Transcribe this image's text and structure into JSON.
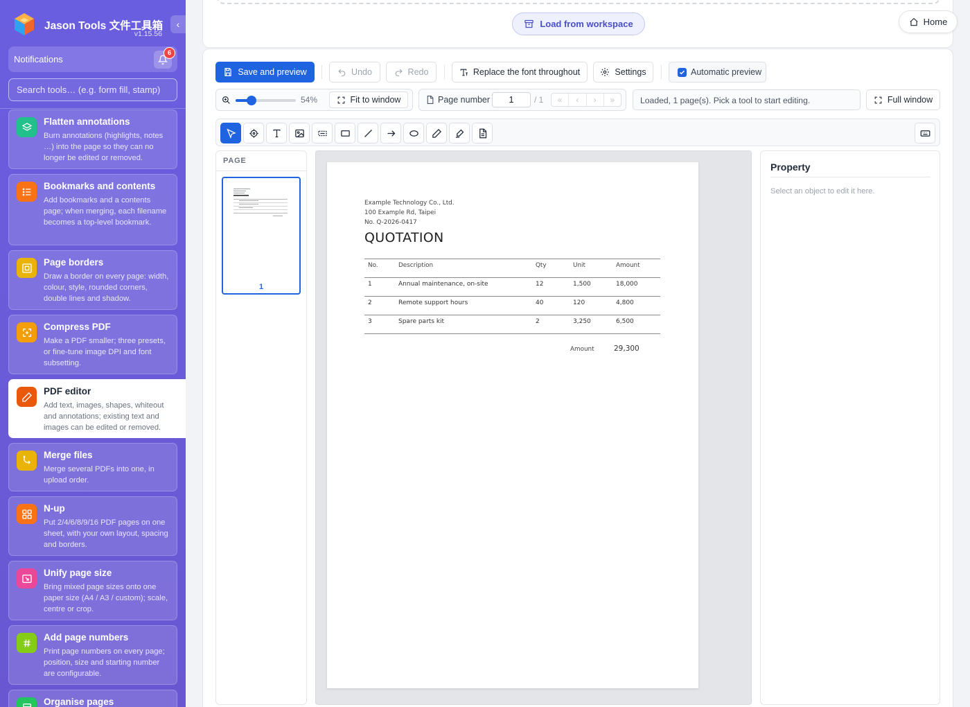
{
  "app": {
    "title": "Jason Tools 文件工具箱",
    "version": "v1.15.56",
    "collapse_label": "‹"
  },
  "notifications": {
    "label": "Notifications",
    "count": "6"
  },
  "search": {
    "placeholder": "Search tools… (e.g. form fill, stamp)"
  },
  "tools": [
    {
      "title": "Flatten annotations",
      "desc": "Burn annotations (highlights, notes …) into the page so they can no longer be edited or removed.",
      "icon": "layers-icon",
      "color": "#22c08a"
    },
    {
      "title": "Bookmarks and contents",
      "desc": "Add bookmarks and a contents page; when merging, each filename becomes a top-level bookmark.",
      "icon": "list-icon",
      "color": "#f97316"
    },
    {
      "title": "Page borders",
      "desc": "Draw a border on every page: width, colour, style, rounded corners, double lines and shadow.",
      "icon": "frame-icon",
      "color": "#eab308"
    },
    {
      "title": "Compress PDF",
      "desc": "Make a PDF smaller; three presets, or fine-tune image DPI and font subsetting.",
      "icon": "compress-icon",
      "color": "#f59e0b"
    },
    {
      "title": "PDF editor",
      "desc": "Add text, images, shapes, whiteout and annotations; existing text and images can be edited or removed.",
      "icon": "pencil-icon",
      "color": "#ea580c",
      "active": true
    },
    {
      "title": "Merge files",
      "desc": "Merge several PDFs into one, in upload order.",
      "icon": "merge-icon",
      "color": "#eab308"
    },
    {
      "title": "N-up",
      "desc": "Put 2/4/6/8/9/16 PDF pages on one sheet, with your own layout, spacing and borders.",
      "icon": "grid-icon",
      "color": "#f97316"
    },
    {
      "title": "Unify page size",
      "desc": "Bring mixed page sizes onto one paper size (A4 / A3 / custom); scale, centre or crop.",
      "icon": "resize-icon",
      "color": "#ec4899"
    },
    {
      "title": "Add page numbers",
      "desc": "Print page numbers on every page; position, size and starting number are configurable.",
      "icon": "hash-icon",
      "color": "#84cc16"
    },
    {
      "title": "Organise pages",
      "desc": "",
      "icon": "pages-icon",
      "color": "#22c55e"
    }
  ],
  "top": {
    "load_label": "Load from workspace",
    "home_label": "Home"
  },
  "toolbar": {
    "save_label": "Save and preview",
    "undo_label": "Undo",
    "redo_label": "Redo",
    "replace_font_label": "Replace the font throughout",
    "settings_label": "Settings",
    "auto_preview_label": "Automatic preview",
    "auto_preview_checked": true,
    "zoom_value": "54%",
    "zoom_fraction": 0.27,
    "fit_label": "Fit to window",
    "page_label": "Page number",
    "page_current": "1",
    "page_total": "/ 1",
    "pager_buttons": [
      "«",
      "‹",
      "›",
      "»"
    ],
    "status": "Loaded, 1 page(s). Pick a tool to start editing.",
    "full_window_label": "Full window"
  },
  "edit_tools": [
    "select-tool-icon",
    "target-icon",
    "text-icon",
    "image-icon",
    "whiteout-icon",
    "rectangle-icon",
    "line-icon",
    "arrow-icon",
    "ellipse-icon",
    "pen-icon",
    "highlighter-icon",
    "note-icon",
    "keyboard-icon"
  ],
  "pages_panel": {
    "heading": "PAGE",
    "thumb_number": "1"
  },
  "document": {
    "company": "Example Technology Co., Ltd.",
    "address": "100 Example Rd, Taipei",
    "number": "No. Q-2026-0417",
    "title": "QUOTATION",
    "headers": [
      "No.",
      "Description",
      "Qty",
      "Unit",
      "Amount"
    ],
    "rows": [
      [
        "1",
        "Annual maintenance, on-site",
        "12",
        "1,500",
        "18,000"
      ],
      [
        "2",
        "Remote support hours",
        "40",
        "120",
        "4,800"
      ],
      [
        "3",
        "Spare parts kit",
        "2",
        "3,250",
        "6,500"
      ]
    ],
    "total_label": "Amount",
    "total_value": "29,300"
  },
  "property": {
    "title": "Property",
    "hint": "Select an object to edit it here."
  }
}
